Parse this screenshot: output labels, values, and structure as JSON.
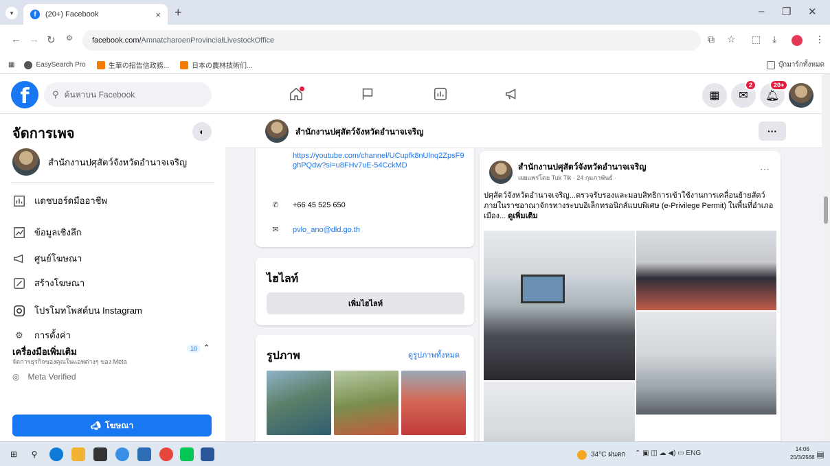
{
  "browser": {
    "tab_title": "(20+) Facebook",
    "tab_close": "×",
    "new_tab": "+",
    "url_host": "facebook.com/",
    "url_path": "AmnatcharoenProvincialLivestockOffice",
    "bookmarks": [
      "EasySearch Pro",
      "生華の招告信政務...",
      "日本の農林技術们..."
    ],
    "bookmark_right": "บุ๊กมาร์กทั้งหมด"
  },
  "fbnav": {
    "search_placeholder": "ค้นหาบน Facebook",
    "messenger_badge": "2",
    "notif_badge": "20+"
  },
  "sidebar": {
    "title": "จัดการเพจ",
    "page_name": "สำนักงานปศุสัตว์จังหวัดอำนาจเจริญ",
    "items": [
      {
        "label": "แดชบอร์ดมืออาชีพ",
        "icon": "dashboard-icon"
      },
      {
        "label": "ข้อมูลเชิงลึก",
        "icon": "insights-icon"
      },
      {
        "label": "ศูนย์โฆษณา",
        "icon": "megaphone-icon"
      },
      {
        "label": "สร้างโฆษณา",
        "icon": "edit-icon"
      },
      {
        "label": "โปรโมทโพสต์บน Instagram",
        "icon": "instagram-icon"
      },
      {
        "label": "การตั้งค่า",
        "icon": "gear-icon"
      }
    ],
    "more_tools_title": "เครื่องมือเพิ่มเติม",
    "more_tools_sub": "จัดการธุรกิจของคุณในแอพต่างๆ ของ Meta",
    "more_tools_count": "10",
    "meta_verified": "Meta Verified",
    "ad_button": "โฆษณา"
  },
  "page_header": {
    "name": "สำนักงานปศุสัตว์จังหวัดอำนาจเจริญ",
    "more": "···"
  },
  "intro": {
    "link": "https://youtube.com/channel/UCupfk8nUlnq2ZpsF9ghPQdw?si=u8FHv7uE-54CckMD",
    "phone": "+66 45 525 650",
    "email": "pvlo_ano@dld.go.th"
  },
  "highlights": {
    "title": "ไฮไลท์",
    "button": "เพิ่มไฮไลท์"
  },
  "photos": {
    "title": "รูปภาพ",
    "see_all": "ดูรูปภาพทั้งหมด"
  },
  "post": {
    "author": "สำนักงานปศุสัตว์จังหวัดอำนาจเจริญ",
    "meta": "เผยแพร่โดย Tuk Tik · 24 กุมภาพันธ์ ·",
    "text": "ปศุสัตว์จังหวัดอำนาจเจริญ...ตรวจรับรองและมอบสิทธิการเข้าใช้งานการเคลื่อนย้ายสัตว์ภายในราชอาณาจักรทางระบบอิเล็กทรอนิกส์แบบพิเศษ (e-Privilege Permit) ในพื้นที่อำเภอเมือง...",
    "see_more": "ดูเพิ่มเติม",
    "more": "···"
  },
  "taskbar": {
    "weather": "34°C ฝนตก",
    "tray": "ENG",
    "time": "14:06",
    "date": "20/3/2568"
  }
}
